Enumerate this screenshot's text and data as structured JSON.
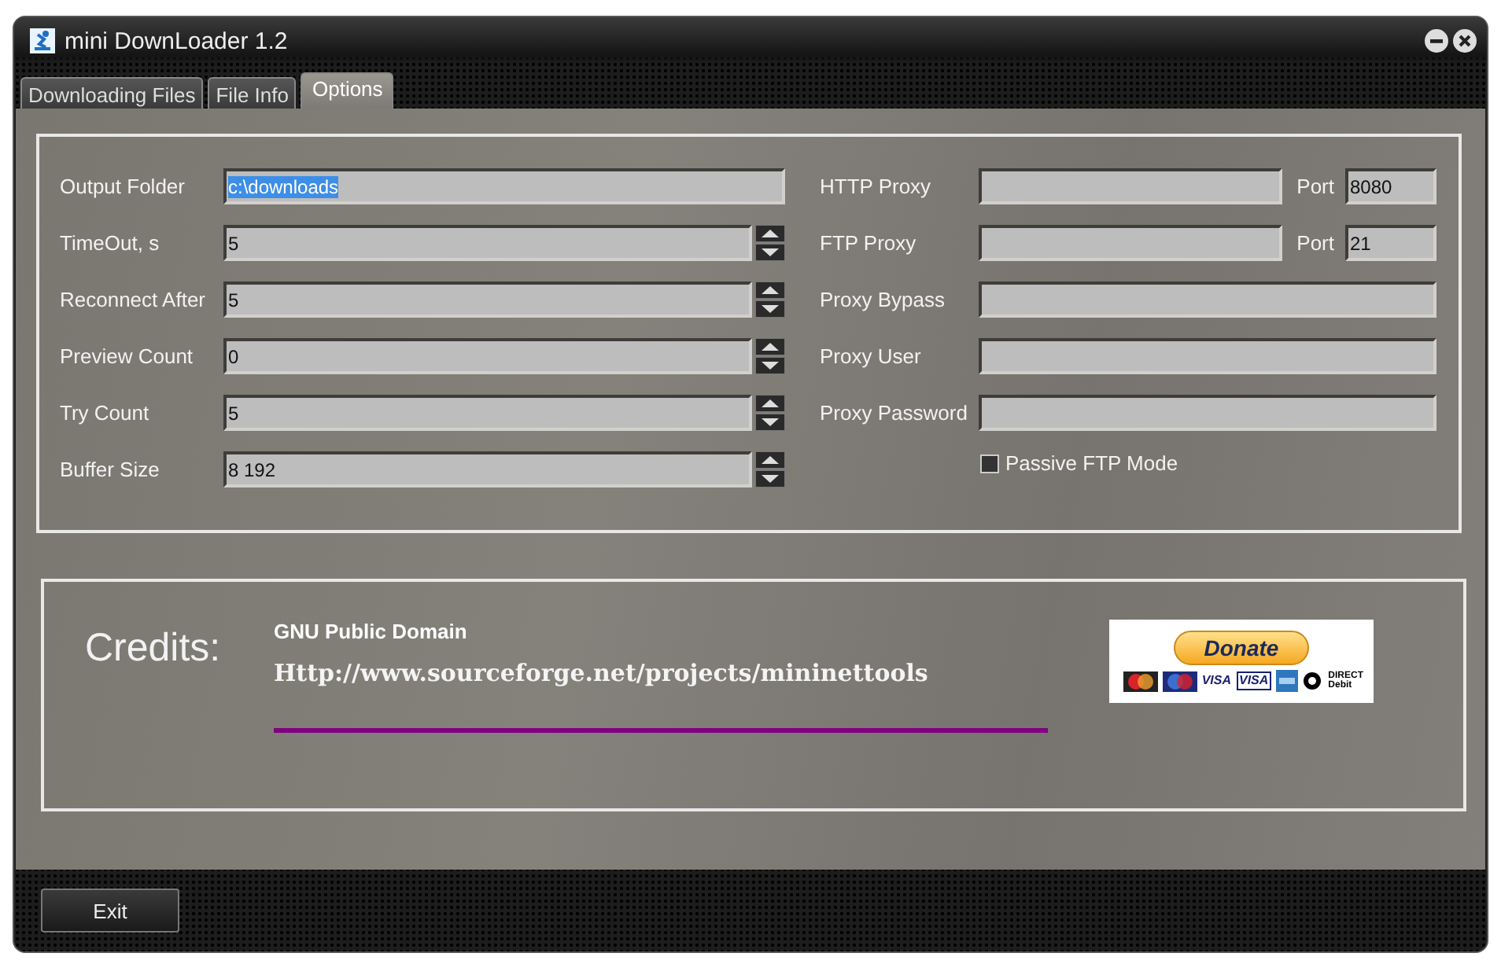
{
  "window": {
    "title": "mini DownLoader 1.2"
  },
  "tabs": [
    {
      "label": "Downloading Files",
      "selected": false
    },
    {
      "label": "File Info",
      "selected": false
    },
    {
      "label": "Options",
      "selected": true
    }
  ],
  "options_left": [
    {
      "label": "Output Folder",
      "value": "c:\\downloads",
      "kind": "text",
      "text_selected": true
    },
    {
      "label": "TimeOut, s",
      "value": "5",
      "kind": "spin",
      "text_selected": false
    },
    {
      "label": "Reconnect After",
      "value": "5",
      "kind": "spin",
      "text_selected": false
    },
    {
      "label": "Preview Count",
      "value": "0",
      "kind": "spin",
      "text_selected": false
    },
    {
      "label": "Try Count",
      "value": "5",
      "kind": "spin",
      "text_selected": false
    },
    {
      "label": "Buffer Size",
      "value": "8 192",
      "kind": "spin",
      "text_selected": false
    }
  ],
  "options_right": [
    {
      "label": "HTTP Proxy",
      "kind": "port",
      "port_label": "Port",
      "port": "8080"
    },
    {
      "label": "FTP Proxy",
      "kind": "port",
      "port_label": "Port",
      "port": "21"
    },
    {
      "label": "Proxy Bypass",
      "kind": "text"
    },
    {
      "label": "Proxy User",
      "kind": "text"
    },
    {
      "label": "Proxy Password",
      "kind": "text"
    }
  ],
  "passive_ftp": {
    "label": "Passive FTP Mode",
    "checked": false
  },
  "credits": {
    "heading": "Credits:",
    "license": "GNU Public Domain",
    "url": "Http://www.sourceforge.net/projects/mininettools"
  },
  "donate": {
    "label": "Donate",
    "cards": [
      {
        "kind": "mastercard"
      },
      {
        "kind": "maestro"
      },
      {
        "kind": "visa",
        "label": "VISA"
      },
      {
        "kind": "visa-electron",
        "label": "VISA"
      },
      {
        "kind": "amex"
      },
      {
        "kind": "direct-debit",
        "label": "DIRECT Debit"
      }
    ]
  },
  "buttons": [
    {
      "label": "Exit"
    }
  ]
}
